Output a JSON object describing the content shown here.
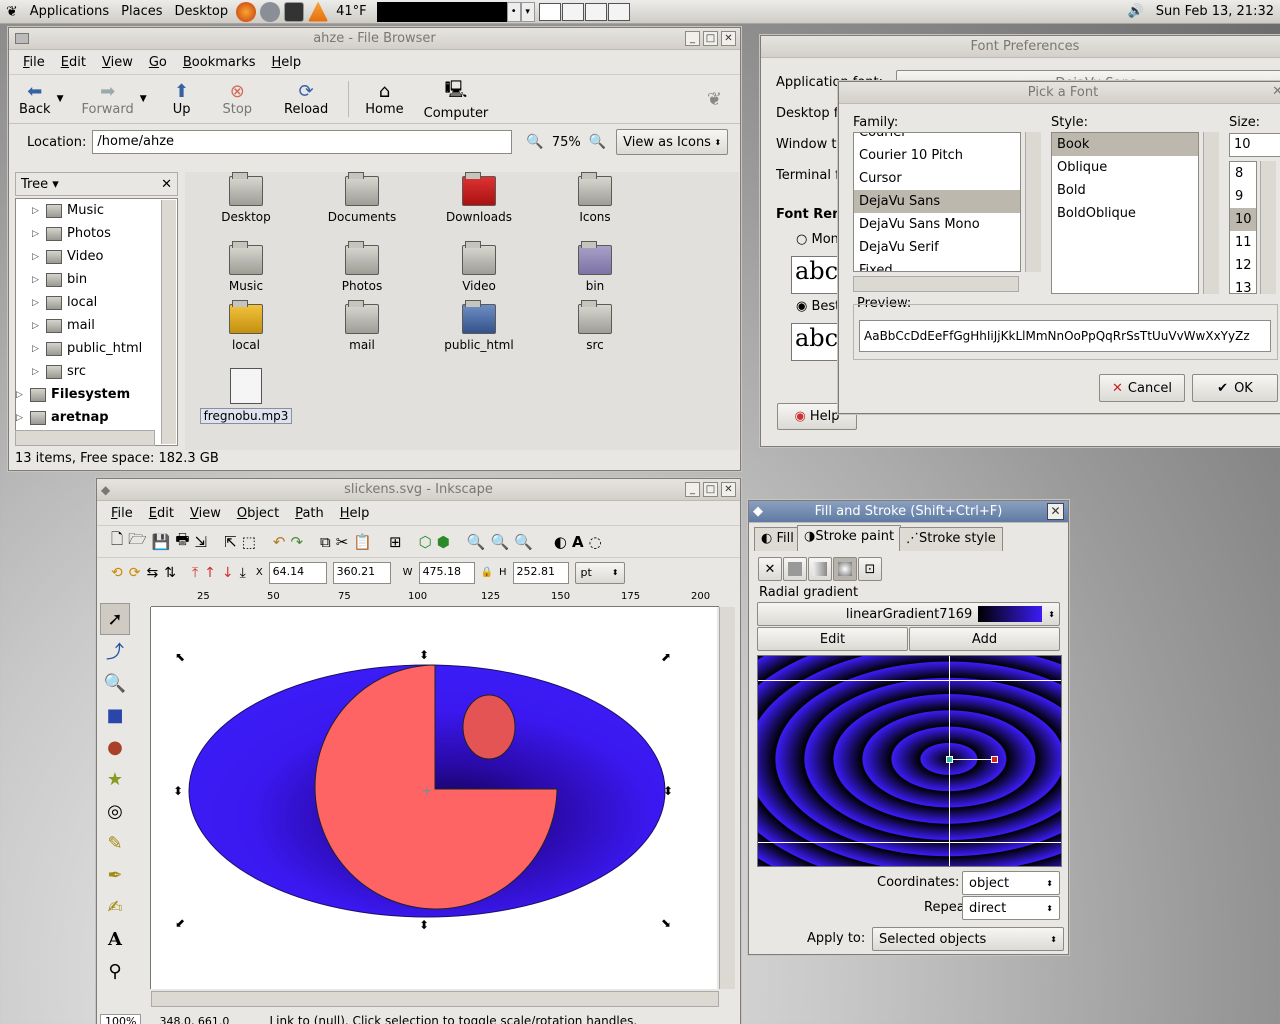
{
  "panel": {
    "menus": [
      "Applications",
      "Places",
      "Desktop"
    ],
    "weather": "41°F",
    "clock": "Sun Feb 13, 21:32"
  },
  "file_browser": {
    "title": "ahze - File Browser",
    "menu": [
      "File",
      "Edit",
      "View",
      "Go",
      "Bookmarks",
      "Help"
    ],
    "toolbar": [
      "Back",
      "Forward",
      "Up",
      "Stop",
      "Reload",
      "Home",
      "Computer"
    ],
    "location_label": "Location:",
    "location_value": "/home/ahze",
    "zoom": "75%",
    "view_mode": "View as Icons",
    "sidebar_title": "Tree",
    "tree": [
      "Music",
      "Photos",
      "Video",
      "bin",
      "local",
      "mail",
      "public_html",
      "src",
      "Filesystem",
      "aretnap"
    ],
    "icons": [
      "Desktop",
      "Documents",
      "Downloads",
      "Icons",
      "Music",
      "Photos",
      "Video",
      "bin",
      "local",
      "mail",
      "public_html",
      "src",
      "fregnobu.mp3"
    ],
    "status": "13 items, Free space: 182.3 GB"
  },
  "font_prefs": {
    "title": "Font Preferences",
    "labels": [
      "Application font:",
      "Desktop font:",
      "Window title font:",
      "Terminal font:"
    ],
    "app_font_value": "DejaVu Sans",
    "section": "Font Rendering",
    "radio1": "Monochrome",
    "radio2": "Best shapes",
    "sample": "abc",
    "help": "Help"
  },
  "pick_font": {
    "title": "Pick a Font",
    "family_label": "Family:",
    "style_label": "Style:",
    "size_label": "Size:",
    "families": [
      "Courier",
      "Courier 10 Pitch",
      "Cursor",
      "DejaVu Sans",
      "DejaVu Sans Mono",
      "DejaVu Serif",
      "Fixed"
    ],
    "styles": [
      "Book",
      "Oblique",
      "Bold",
      "BoldOblique"
    ],
    "size_value": "10",
    "sizes": [
      "8",
      "9",
      "10",
      "11",
      "12",
      "13"
    ],
    "preview_label": "Preview:",
    "preview_text": "AaBbCcDdEeFfGgHhIiJjKkLlMmNnOoPpQqRrSsTtUuVvWwXxYyZz",
    "cancel": "Cancel",
    "ok": "OK"
  },
  "inkscape": {
    "title": "slickens.svg - Inkscape",
    "menu": [
      "File",
      "Edit",
      "View",
      "Object",
      "Path",
      "Help"
    ],
    "x_label": "X",
    "x": "64.14",
    "y": "360.21",
    "w_label": "W",
    "w": "475.18",
    "h_label": "H",
    "h": "252.81",
    "unit": "pt",
    "ruler": [
      "25",
      "50",
      "75",
      "100",
      "125",
      "150",
      "175",
      "200"
    ],
    "zoom": "100%",
    "coords": "348.0, 661.0",
    "status": "Link to (null). Click selection to toggle scale/rotation handles."
  },
  "fill_stroke": {
    "title": "Fill and Stroke (Shift+Ctrl+F)",
    "tabs": [
      "Fill",
      "Stroke paint",
      "Stroke style"
    ],
    "mode": "Radial gradient",
    "gradient": "linearGradient7169",
    "edit": "Edit",
    "add": "Add",
    "coordinates_label": "Coordinates:",
    "coordinates": "object",
    "repeat_label": "Repeat:",
    "repeat": "direct",
    "apply_label": "Apply to:",
    "apply": "Selected objects"
  }
}
